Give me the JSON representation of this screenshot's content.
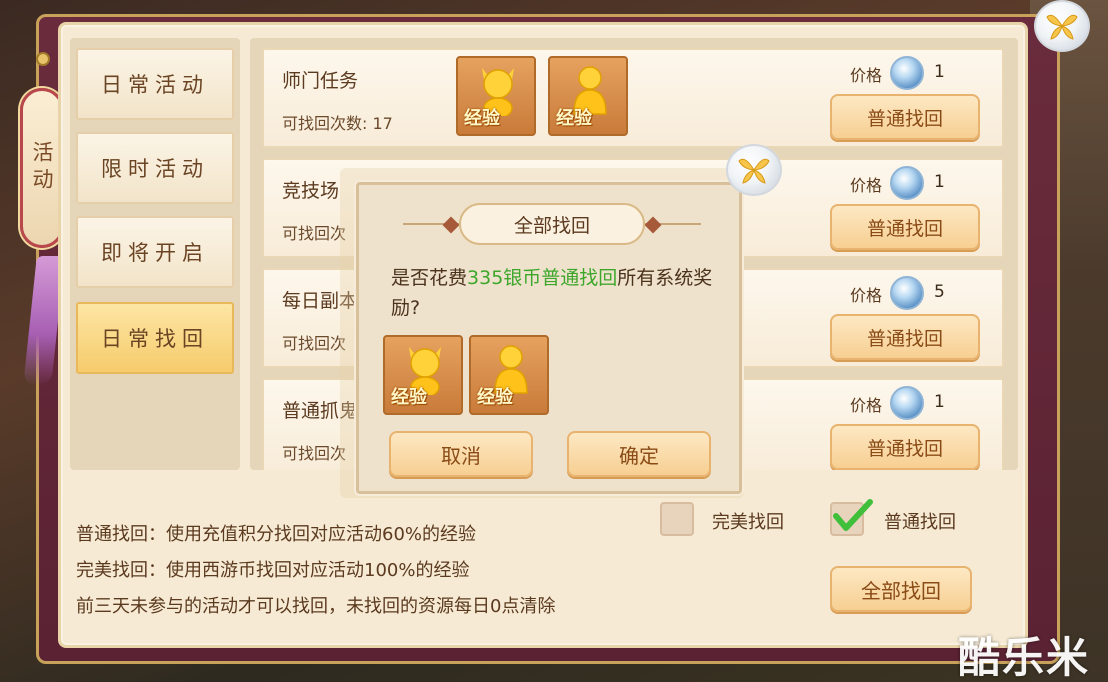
{
  "side_tab": {
    "label": "活动"
  },
  "menu": {
    "items": [
      {
        "label": "日常活动",
        "active": false
      },
      {
        "label": "限时活动",
        "active": false
      },
      {
        "label": "即将开启",
        "active": false
      },
      {
        "label": "日常找回",
        "active": true
      }
    ]
  },
  "list": {
    "price_label": "价格",
    "rows": [
      {
        "name": "师门任务",
        "count": "可找回次数: 17",
        "price": "1",
        "button": "普通找回"
      },
      {
        "name": "竞技场",
        "count": "可找回次",
        "price": "1",
        "button": "普通找回"
      },
      {
        "name": "每日副本",
        "count": "可找回次",
        "price": "5",
        "button": "普通找回"
      },
      {
        "name": "普通抓鬼",
        "count": "可找回次",
        "price": "1",
        "button": "普通找回"
      }
    ]
  },
  "reward_icons": {
    "label": "经验"
  },
  "description": {
    "line1": "普通找回：使用充值积分找回对应活动60%的经验",
    "line2": "完美找回：使用西游币找回对应活动100%的经验",
    "line3": "前三天未参与的活动才可以找回，未找回的资源每日0点清除"
  },
  "options": {
    "perfect": {
      "label": "完美找回",
      "checked": false
    },
    "normal": {
      "label": "普通找回",
      "checked": true
    }
  },
  "recover_all_button": "全部找回",
  "dialog": {
    "title": "全部找回",
    "msg_prefix": "是否花费",
    "msg_highlight": "335银币普通找回",
    "msg_suffix": "所有系统奖励?",
    "cancel": "取消",
    "confirm": "确定"
  },
  "watermark": "酷乐米",
  "colors": {
    "highlight": "#3da72c",
    "button_text": "#8a4b16",
    "frame": "#6a2c3c"
  }
}
